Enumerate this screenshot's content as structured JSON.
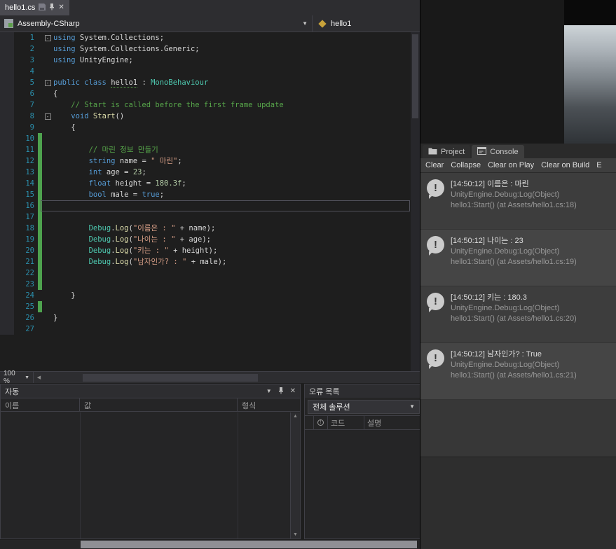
{
  "vs": {
    "tab": {
      "title": "hello1.cs"
    },
    "navbar": {
      "project": "Assembly-CSharp",
      "type": "hello1"
    },
    "zoom": "100 %",
    "autos": {
      "title": "자동",
      "columns": [
        "이름",
        "값",
        "형식"
      ]
    },
    "error_list": {
      "title": "오류 목록",
      "scope": "전체 솔루션",
      "columns": [
        "코드",
        "설명"
      ]
    },
    "editor": {
      "lines": [
        {
          "n": 1,
          "fold": true,
          "t": [
            [
              "kw",
              "using"
            ],
            [
              "pl",
              " System.Collections;"
            ]
          ]
        },
        {
          "n": 2,
          "t": [
            [
              "kw",
              "using"
            ],
            [
              "pl",
              " System.Collections.Generic;"
            ]
          ]
        },
        {
          "n": 3,
          "t": [
            [
              "kw",
              "using"
            ],
            [
              "pl",
              " UnityEngine;"
            ]
          ]
        },
        {
          "n": 4,
          "t": []
        },
        {
          "n": 5,
          "fold": true,
          "t": [
            [
              "kw",
              "public class "
            ],
            [
              "def",
              "hello1"
            ],
            [
              "pl",
              " : "
            ],
            [
              "ty",
              "MonoBehaviour"
            ]
          ]
        },
        {
          "n": 6,
          "t": [
            [
              "pl",
              "{"
            ]
          ]
        },
        {
          "n": 7,
          "t": [
            [
              "co",
              "    // Start is called before the first frame update"
            ]
          ]
        },
        {
          "n": 8,
          "fold": true,
          "t": [
            [
              "pl",
              "    "
            ],
            [
              "kw",
              "void"
            ],
            [
              "pl",
              " "
            ],
            [
              "me",
              "Start"
            ],
            [
              "pl",
              "()"
            ]
          ]
        },
        {
          "n": 9,
          "t": [
            [
              "pl",
              "    {"
            ]
          ]
        },
        {
          "n": 10,
          "chg": true,
          "t": []
        },
        {
          "n": 11,
          "chg": true,
          "t": [
            [
              "co",
              "        // 마린 정보 만들기"
            ]
          ]
        },
        {
          "n": 12,
          "chg": true,
          "t": [
            [
              "pl",
              "        "
            ],
            [
              "kw",
              "string"
            ],
            [
              "pl",
              " name = "
            ],
            [
              "st",
              "\" 마린\""
            ],
            [
              "pl",
              ";"
            ]
          ]
        },
        {
          "n": 13,
          "chg": true,
          "t": [
            [
              "pl",
              "        "
            ],
            [
              "kw",
              "int"
            ],
            [
              "pl",
              " age = "
            ],
            [
              "nu",
              "23"
            ],
            [
              "pl",
              ";"
            ]
          ]
        },
        {
          "n": 14,
          "chg": true,
          "t": [
            [
              "pl",
              "        "
            ],
            [
              "kw",
              "float"
            ],
            [
              "pl",
              " height = "
            ],
            [
              "nu",
              "180.3f"
            ],
            [
              "pl",
              ";"
            ]
          ]
        },
        {
          "n": 15,
          "chg": true,
          "t": [
            [
              "pl",
              "        "
            ],
            [
              "kw",
              "bool"
            ],
            [
              "pl",
              " male = "
            ],
            [
              "kw",
              "true"
            ],
            [
              "pl",
              ";"
            ]
          ]
        },
        {
          "n": 16,
          "chg": true,
          "cur": true,
          "t": []
        },
        {
          "n": 17,
          "chg": true,
          "t": []
        },
        {
          "n": 18,
          "chg": true,
          "t": [
            [
              "pl",
              "        "
            ],
            [
              "ty",
              "Debug"
            ],
            [
              "pl",
              "."
            ],
            [
              "me",
              "Log"
            ],
            [
              "pl",
              "("
            ],
            [
              "st",
              "\"이름은 : \""
            ],
            [
              "pl",
              " + name);"
            ]
          ]
        },
        {
          "n": 19,
          "chg": true,
          "t": [
            [
              "pl",
              "        "
            ],
            [
              "ty",
              "Debug"
            ],
            [
              "pl",
              "."
            ],
            [
              "me",
              "Log"
            ],
            [
              "pl",
              "("
            ],
            [
              "st",
              "\"나이는 : \""
            ],
            [
              "pl",
              " + age);"
            ]
          ]
        },
        {
          "n": 20,
          "chg": true,
          "t": [
            [
              "pl",
              "        "
            ],
            [
              "ty",
              "Debug"
            ],
            [
              "pl",
              "."
            ],
            [
              "me",
              "Log"
            ],
            [
              "pl",
              "("
            ],
            [
              "st",
              "\"키는 : \""
            ],
            [
              "pl",
              " + height);"
            ]
          ]
        },
        {
          "n": 21,
          "chg": true,
          "t": [
            [
              "pl",
              "        "
            ],
            [
              "ty",
              "Debug"
            ],
            [
              "pl",
              "."
            ],
            [
              "me",
              "Log"
            ],
            [
              "pl",
              "("
            ],
            [
              "st",
              "\"남자인가? : \""
            ],
            [
              "pl",
              " + male);"
            ]
          ]
        },
        {
          "n": 22,
          "chg": true,
          "t": []
        },
        {
          "n": 23,
          "chg": true,
          "t": []
        },
        {
          "n": 24,
          "t": [
            [
              "pl",
              "    }"
            ]
          ]
        },
        {
          "n": 25,
          "chg": true,
          "t": []
        },
        {
          "n": 26,
          "t": [
            [
              "pl",
              "}"
            ]
          ]
        },
        {
          "n": 27,
          "t": []
        }
      ]
    }
  },
  "unity": {
    "tabs": [
      {
        "label": "Project"
      },
      {
        "label": "Console"
      }
    ],
    "toolbar": [
      "Clear",
      "Collapse",
      "Clear on Play",
      "Clear on Build",
      "E"
    ],
    "logs": [
      {
        "msg": "[14:50:12] 이름은 :  마린",
        "stack1": "UnityEngine.Debug:Log(Object)",
        "stack2": "hello1:Start() (at Assets/hello1.cs:18)"
      },
      {
        "msg": "[14:50:12] 나이는 : 23",
        "stack1": "UnityEngine.Debug:Log(Object)",
        "stack2": "hello1:Start() (at Assets/hello1.cs:19)"
      },
      {
        "msg": "[14:50:12] 키는 : 180.3",
        "stack1": "UnityEngine.Debug:Log(Object)",
        "stack2": "hello1:Start() (at Assets/hello1.cs:20)"
      },
      {
        "msg": "[14:50:12] 남자인가? : True",
        "stack1": "UnityEngine.Debug:Log(Object)",
        "stack2": "hello1:Start() (at Assets/hello1.cs:21)"
      }
    ]
  },
  "colors": {
    "keyword": "#569cd6",
    "type": "#4ec9b0",
    "string": "#d69d85",
    "number": "#b5cea8",
    "comment": "#57a64a",
    "line_number": "#2b91af",
    "change_bar": "#4ea24e"
  }
}
